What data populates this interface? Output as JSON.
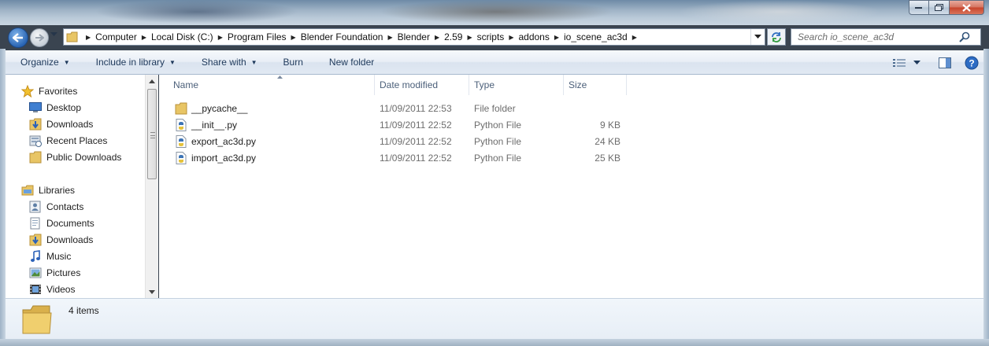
{
  "window": {
    "caption_buttons": [
      "minimize",
      "maximize",
      "close"
    ]
  },
  "address": {
    "crumbs": [
      "Computer",
      "Local Disk (C:)",
      "Program Files",
      "Blender Foundation",
      "Blender",
      "2.59",
      "scripts",
      "addons",
      "io_scene_ac3d"
    ]
  },
  "search": {
    "placeholder": "Search io_scene_ac3d"
  },
  "toolbar": {
    "organize": "Organize",
    "include_in_library": "Include in library",
    "share_with": "Share with",
    "burn": "Burn",
    "new_folder": "New folder"
  },
  "sidebar": {
    "favorites": {
      "label": "Favorites",
      "items": [
        {
          "label": "Desktop",
          "icon": "desktop-icon"
        },
        {
          "label": "Downloads",
          "icon": "downloads-icon"
        },
        {
          "label": "Recent Places",
          "icon": "recent-places-icon"
        },
        {
          "label": "Public Downloads",
          "icon": "folder-icon"
        }
      ]
    },
    "libraries": {
      "label": "Libraries",
      "items": [
        {
          "label": "Contacts",
          "icon": "contacts-icon"
        },
        {
          "label": "Documents",
          "icon": "documents-icon"
        },
        {
          "label": "Downloads",
          "icon": "downloads-icon"
        },
        {
          "label": "Music",
          "icon": "music-icon"
        },
        {
          "label": "Pictures",
          "icon": "pictures-icon"
        },
        {
          "label": "Videos",
          "icon": "videos-icon"
        }
      ]
    }
  },
  "columns": {
    "name": "Name",
    "date": "Date modified",
    "type": "Type",
    "size": "Size"
  },
  "files": [
    {
      "name": "__pycache__",
      "date": "11/09/2011 22:53",
      "type": "File folder",
      "size": "",
      "icon": "folder-icon"
    },
    {
      "name": "__init__.py",
      "date": "11/09/2011 22:52",
      "type": "Python File",
      "size": "9 KB",
      "icon": "python-file-icon"
    },
    {
      "name": "export_ac3d.py",
      "date": "11/09/2011 22:52",
      "type": "Python File",
      "size": "24 KB",
      "icon": "python-file-icon"
    },
    {
      "name": "import_ac3d.py",
      "date": "11/09/2011 22:52",
      "type": "Python File",
      "size": "25 KB",
      "icon": "python-file-icon"
    }
  ],
  "status": {
    "count": "4 items"
  },
  "colors": {
    "link_blue": "#1e395b",
    "meta_gray": "#6d6d6d",
    "header_gray": "#4c607a"
  }
}
